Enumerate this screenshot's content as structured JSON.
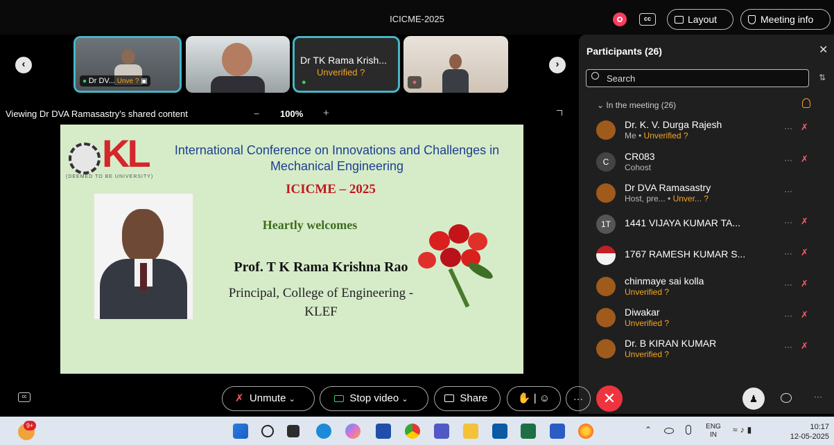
{
  "window": {
    "title": "ICICME-2025"
  },
  "topbar": {
    "layout_label": "Layout",
    "meeting_info_label": "Meeting info"
  },
  "tiles": [
    {
      "name": "Dr DV...",
      "status": "Unve"
    },
    {
      "name": "",
      "status": ""
    },
    {
      "name": "Dr TK Rama Krish...",
      "status": "Unverified"
    },
    {
      "name": "",
      "status": ""
    }
  ],
  "view": {
    "shared_text": "Viewing Dr DVA Ramasastry's shared content",
    "zoom": "100%",
    "minus": "−",
    "plus": "+"
  },
  "slide": {
    "logo_sub": "(DEEMED TO BE UNIVERSITY)",
    "heading_line1": "International Conference on Innovations and Challenges in",
    "heading_line2": "Mechanical Engineering",
    "event": "ICICME – 2025",
    "welcome": "Heartly welcomes",
    "speaker": "Prof. T K Rama Krishna Rao",
    "designation_line1": "Principal, College of Engineering -",
    "designation_line2": "KLEF"
  },
  "panel": {
    "title": "Participants (26)",
    "search_placeholder": "Search",
    "section": "In the meeting (26)",
    "participants": [
      {
        "name": "Dr. K. V. Durga Rajesh",
        "sub": "Me",
        "status": "Unverified",
        "avatar": "person-icon"
      },
      {
        "name": "CR083",
        "sub": "Cohost",
        "status": "",
        "avatar": "C"
      },
      {
        "name": "Dr DVA Ramasastry",
        "sub": "Host, pre...",
        "status": "Unver...",
        "avatar": "person-icon"
      },
      {
        "name": "1441 VIJAYA KUMAR TA...",
        "sub": "",
        "status": "",
        "avatar": "1T"
      },
      {
        "name": "1767 RAMESH KUMAR S...",
        "sub": "",
        "status": "",
        "avatar": "photo"
      },
      {
        "name": "chinmaye sai kolla",
        "sub": "",
        "status": "Unverified",
        "avatar": "person-icon"
      },
      {
        "name": "Diwakar",
        "sub": "",
        "status": "Unverified",
        "avatar": "person-icon"
      },
      {
        "name": "Dr. B KIRAN KUMAR",
        "sub": "",
        "status": "Unverified",
        "avatar": "person-icon"
      }
    ]
  },
  "controls": {
    "unmute": "Unmute",
    "stop_video": "Stop video",
    "share": "Share"
  },
  "taskbar": {
    "badge": "9+",
    "lang_line1": "ENG",
    "lang_line2": "IN",
    "time": "10:17",
    "date": "12-05-2025"
  },
  "colors": {
    "accent": "#46b6c6",
    "unverified": "#f5a623",
    "end_call": "#f0343f",
    "rec": "#ff3b5c",
    "slide_bg": "#d6ecc9",
    "heading_blue": "#1d3f8f",
    "event_red": "#c0171f",
    "welcome_green": "#3f6b1e"
  }
}
